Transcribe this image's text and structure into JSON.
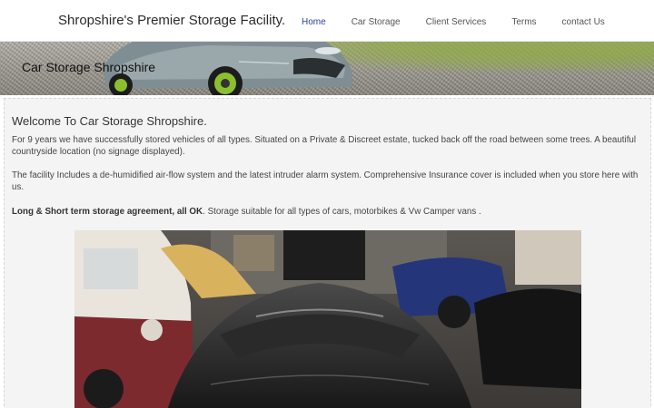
{
  "header": {
    "site_title": "Shropshire's Premier Storage Facility.",
    "nav": [
      {
        "label": "Home",
        "active": true
      },
      {
        "label": "Car Storage",
        "active": false
      },
      {
        "label": "Client Services",
        "active": false
      },
      {
        "label": "Terms",
        "active": false
      },
      {
        "label": "contact Us",
        "active": false
      }
    ]
  },
  "banner": {
    "title": "Car Storage Shropshire"
  },
  "main": {
    "heading": "Welcome To Car Storage Shropshire.",
    "paragraph1": "For 9 years we have successfully stored vehicles of all types. Situated on a Private & Discreet estate, tucked back off the road between some trees. A beautiful countryside location (no signage displayed).",
    "paragraph2": "The facility Includes a de-humidified air-flow system and the latest intruder alarm system. Comprehensive Insurance cover is included when you store here with us.",
    "paragraph3_bold": "Long & Short term storage agreement, all OK",
    "paragraph3_rest": ". Storage suitable for all types of cars, motorbikes & Vw Camper vans ."
  },
  "colors": {
    "nav_active": "#2c3e9a",
    "nav_default": "#555555",
    "content_bg": "#f4f4f4"
  }
}
